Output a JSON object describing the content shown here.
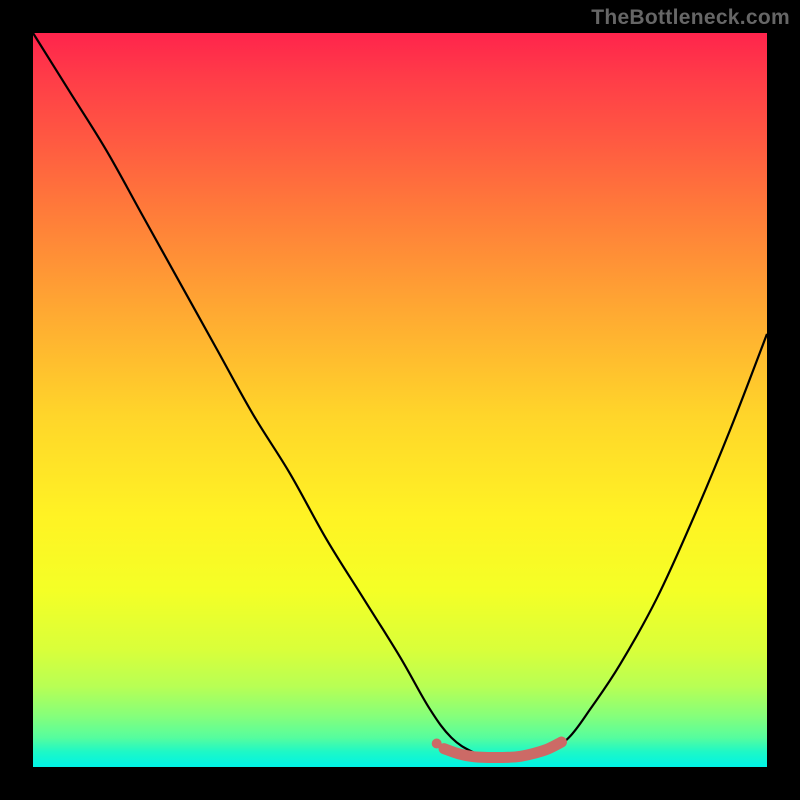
{
  "watermark": "TheBottleneck.com",
  "chart_data": {
    "type": "line",
    "title": "",
    "xlabel": "",
    "ylabel": "",
    "xlim": [
      0,
      100
    ],
    "ylim": [
      0,
      100
    ],
    "series": [
      {
        "name": "bottleneck-curve",
        "color": "#000000",
        "x": [
          0,
          5,
          10,
          15,
          20,
          25,
          30,
          35,
          40,
          45,
          50,
          54,
          57,
          60,
          63,
          66,
          70,
          73,
          76,
          80,
          85,
          90,
          95,
          100
        ],
        "y": [
          100,
          92,
          84,
          75,
          66,
          57,
          48,
          40,
          31,
          23,
          15,
          8,
          4,
          2,
          1,
          1,
          2,
          4,
          8,
          14,
          23,
          34,
          46,
          59
        ]
      },
      {
        "name": "optimal-range-marker",
        "color": "#cc6a66",
        "x": [
          56,
          58,
          60,
          62,
          64,
          66,
          68,
          70,
          72
        ],
        "y": [
          2.5,
          1.8,
          1.4,
          1.3,
          1.3,
          1.4,
          1.8,
          2.4,
          3.4
        ]
      }
    ],
    "annotations": []
  }
}
